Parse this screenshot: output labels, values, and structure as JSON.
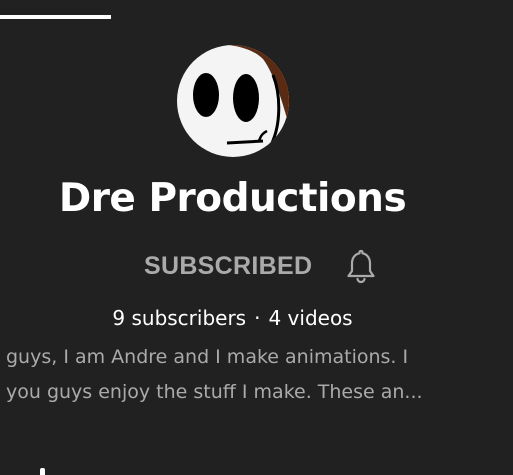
{
  "header": {
    "active_tab_indicator": "tab-underline"
  },
  "channel": {
    "name": "Dre Productions",
    "avatar_icon": "cartoon-face-avatar",
    "subscribe_label": "SUBSCRIBED",
    "notification_icon": "bell-icon",
    "subscribers": "9 subscribers",
    "separator": "·",
    "videos": "4 videos",
    "description_lines": [
      "guys, I am Andre and I make animations. I",
      "you guys enjoy the stuff I make. These an..."
    ]
  },
  "colors": {
    "background": "#212121",
    "primary_text": "#ffffff",
    "secondary_text": "#aaaaaa"
  }
}
